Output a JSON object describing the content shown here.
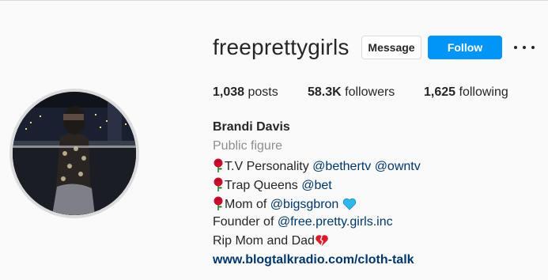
{
  "profile": {
    "username": "freeprettygirls",
    "message_label": "Message",
    "follow_label": "Follow",
    "stats": {
      "posts_value": "1,038",
      "posts_label": "posts",
      "followers_value": "58.3K",
      "followers_label": "followers",
      "following_value": "1,625",
      "following_label": "following"
    },
    "bio": {
      "name": "Brandi Davis",
      "category": "Public figure",
      "line1_text": "T.V Personality",
      "line1_mention1": "@bethertv",
      "line1_mention2": "@owntv",
      "line2_text": "Trap Queens",
      "line2_mention": "@bet",
      "line3_text": "Mom of",
      "line3_mention": "@bigsgbron",
      "line4_text": "Founder of",
      "line4_mention": "@free.pretty.girls.inc",
      "line5_text": "Rip Mom and Dad",
      "link": "www.blogtalkradio.com/cloth-talk"
    },
    "icons": {
      "rose": "rose-icon",
      "blue_heart": "blue-heart-icon",
      "broken_heart": "broken-heart-icon",
      "more": "more-options-icon"
    },
    "colors": {
      "follow_button": "#0095f6",
      "mention": "#00376b",
      "secondary_text": "#8e8e8e",
      "blue_heart": "#2fb7ea",
      "broken_heart": "#d91e2b",
      "rose": "#c8102e"
    }
  }
}
